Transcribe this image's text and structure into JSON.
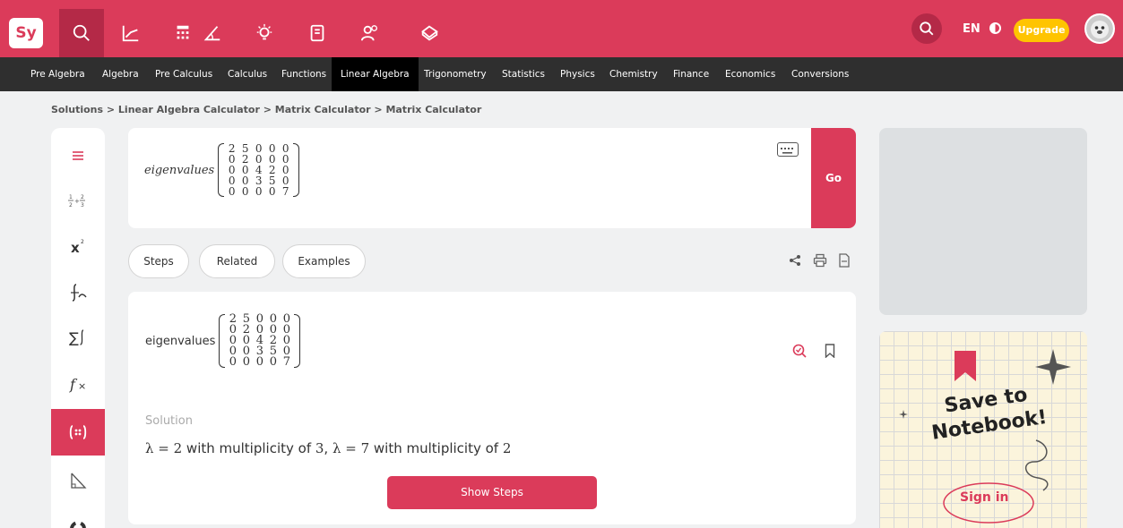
{
  "brand": {
    "logo_text": "Sy",
    "accent": "#db3b5a"
  },
  "topbar": {
    "tools": [
      "search-icon",
      "graph-icon",
      "calculator-icon",
      "angle-icon",
      "lightbulb-icon",
      "notebook-icon",
      "people-icon",
      "eraser-icon"
    ],
    "lang": "EN",
    "upgrade_label": "Upgrade"
  },
  "subjects": [
    "Pre Algebra",
    "Algebra",
    "Pre Calculus",
    "Calculus",
    "Functions",
    "Linear Algebra",
    "Trigonometry",
    "Statistics",
    "Physics",
    "Chemistry",
    "Finance",
    "Economics",
    "Conversions"
  ],
  "active_subject": "Linear Algebra",
  "breadcrumb": "Solutions > Linear Algebra Calculator > Matrix Calculator > Matrix Calculator",
  "input": {
    "function": "eigenvalues",
    "matrix": [
      [
        "2",
        "5",
        "0",
        "0",
        "0"
      ],
      [
        "0",
        "2",
        "0",
        "0",
        "0"
      ],
      [
        "0",
        "0",
        "4",
        "2",
        "0"
      ],
      [
        "0",
        "0",
        "3",
        "5",
        "0"
      ],
      [
        "0",
        "0",
        "0",
        "0",
        "7"
      ]
    ],
    "go_label": "Go"
  },
  "tabs": [
    "Steps",
    "Related",
    "Examples"
  ],
  "result": {
    "function": "eigenvalues",
    "solution_label": "Solution",
    "answer": {
      "lambda1": "λ = 2",
      "text1": " with multiplicity of ",
      "mult1": "3",
      "comma": ", ",
      "lambda2": "λ = 7",
      "text2": " with multiplicity of ",
      "mult2": "2"
    },
    "show_steps_label": "Show Steps"
  },
  "promo": {
    "title": "Save to Notebook!",
    "signin": "Sign in"
  }
}
